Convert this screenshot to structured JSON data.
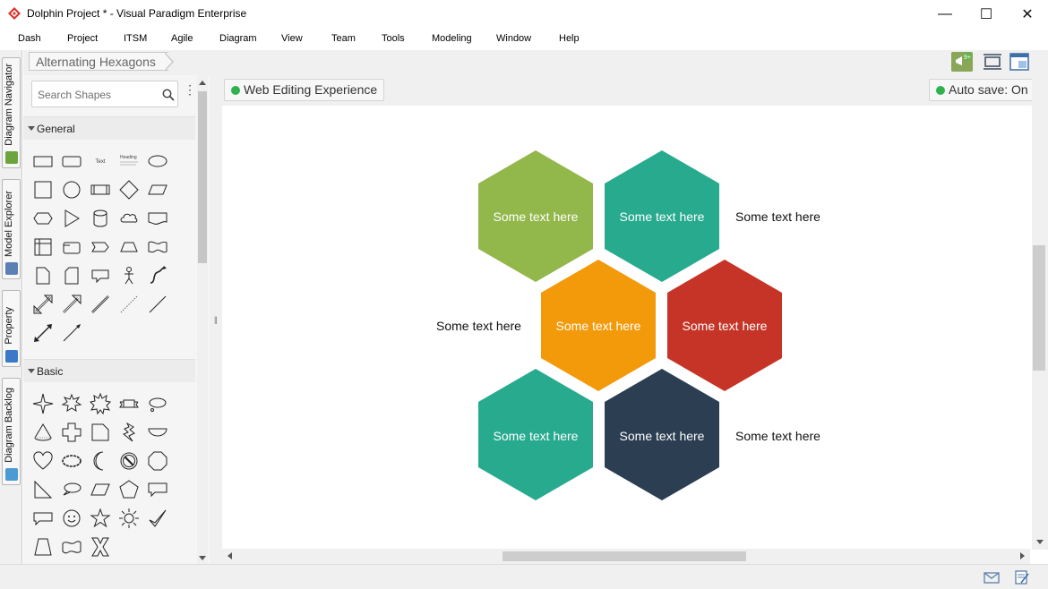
{
  "window": {
    "title": "Dolphin Project * - Visual Paradigm Enterprise",
    "minimize": "—",
    "maximize": "☐",
    "close": "✕"
  },
  "menu": [
    "Dash",
    "Project",
    "ITSM",
    "Agile",
    "Diagram",
    "View",
    "Team",
    "Tools",
    "Modeling",
    "Window",
    "Help"
  ],
  "left_tabs": [
    "Diagram Navigator",
    "Model Explorer",
    "Property",
    "Diagram Backlog"
  ],
  "breadcrumb": "Alternating Hexagons",
  "toolbar_icons": [
    "announcement-icon",
    "fit-diagram-icon",
    "layout-icon"
  ],
  "notification_badge": "9+",
  "shapes_panel": {
    "search_placeholder": "Search Shapes",
    "sections": [
      {
        "label": "General"
      },
      {
        "label": "Basic"
      }
    ],
    "mini_text": "Text",
    "mini_heading": "Heading"
  },
  "editing_pill": "Web Editing Experience",
  "autosave_pill": "Auto save: On",
  "colors": {
    "green": "#92b74a",
    "teal": "#27aa8e",
    "orange": "#f39a0a",
    "red": "#c53427",
    "navy": "#2b3e52",
    "status_dot": "#2fb24c"
  },
  "hexagons": [
    {
      "text": "Some text here",
      "color": "#92b74a"
    },
    {
      "text": "Some text here",
      "color": "#27aa8e"
    },
    {
      "text": "Some text here",
      "color": "#f39a0a"
    },
    {
      "text": "Some text here",
      "color": "#c53427"
    },
    {
      "text": "Some text here",
      "color": "#27aa8e"
    },
    {
      "text": "Some text here",
      "color": "#2b3e52"
    }
  ],
  "side_labels": [
    "Some text here",
    "Some text here",
    "Some text here"
  ]
}
